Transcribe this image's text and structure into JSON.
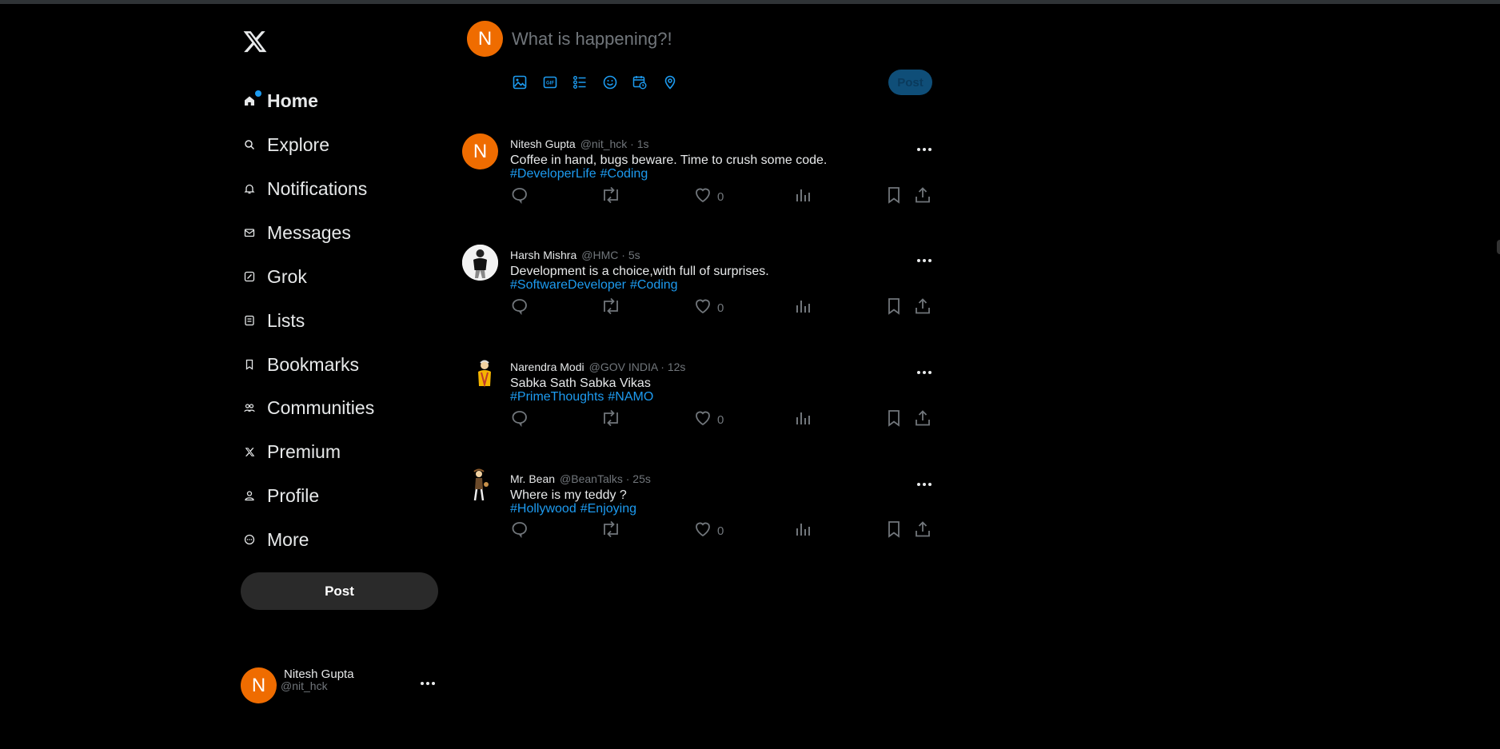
{
  "colors": {
    "accent": "#1d9bf0",
    "avatar_bg": "#ef6c00",
    "background": "#000000",
    "muted": "#71767b"
  },
  "sidebar": {
    "logo_icon": "x-logo-icon",
    "items": [
      {
        "label": "Home",
        "icon": "home-icon",
        "active": true
      },
      {
        "label": "Explore",
        "icon": "search-icon"
      },
      {
        "label": "Notifications",
        "icon": "bell-icon"
      },
      {
        "label": "Messages",
        "icon": "envelope-icon"
      },
      {
        "label": "Grok",
        "icon": "grok-icon"
      },
      {
        "label": "Lists",
        "icon": "list-icon"
      },
      {
        "label": "Bookmarks",
        "icon": "bookmark-icon"
      },
      {
        "label": "Communities",
        "icon": "people-icon"
      },
      {
        "label": "Premium",
        "icon": "x-icon"
      },
      {
        "label": "Profile",
        "icon": "person-icon"
      },
      {
        "label": "More",
        "icon": "more-circle-icon"
      }
    ],
    "post_label": "Post",
    "account": {
      "initial": "N",
      "name": "Nitesh Gupta",
      "handle": "@nit_hck"
    }
  },
  "composer": {
    "initial": "N",
    "placeholder": "What is happening?!",
    "tools": [
      "image-icon",
      "gif-icon",
      "poll-icon",
      "emoji-icon",
      "schedule-icon",
      "location-icon"
    ],
    "post_label": "Post"
  },
  "tweets": [
    {
      "name": "Nitesh Gupta",
      "handle": "@nit_hck",
      "time": "1s",
      "text": "Coffee in hand, bugs beware. Time to crush some code.",
      "tags": [
        "#DeveloperLife",
        "#Coding"
      ],
      "likes": "0",
      "avatar": "initial",
      "initial": "N"
    },
    {
      "name": "Harsh Mishra",
      "handle": "@HMC",
      "time": "5s",
      "text": "Development is a choice,with full of surprises.",
      "tags": [
        "#SoftwareDeveloper",
        "#Coding"
      ],
      "likes": "0",
      "avatar": "photo"
    },
    {
      "name": "Narendra Modi",
      "handle": "@GOV INDIA",
      "time": "12s",
      "text": "Sabka Sath Sabka Vikas",
      "tags": [
        "#PrimeThoughts",
        "#NAMO"
      ],
      "likes": "0",
      "avatar": "cartoon"
    },
    {
      "name": "Mr. Bean",
      "handle": "@BeanTalks",
      "time": "25s",
      "text": "Where is my teddy ?",
      "tags": [
        "#Hollywood",
        "#Enjoying"
      ],
      "likes": "0",
      "avatar": "cartoon"
    }
  ]
}
